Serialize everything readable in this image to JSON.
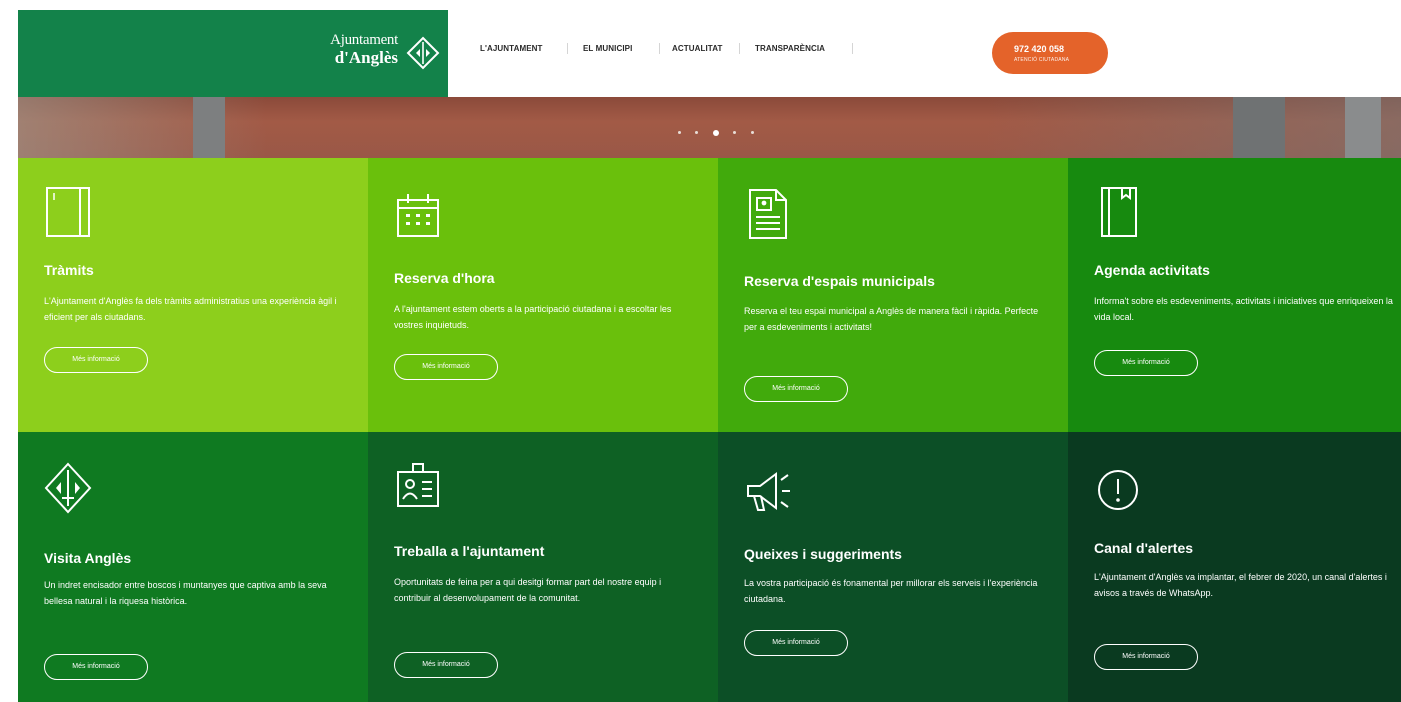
{
  "header": {
    "logo_line1": "Ajuntament",
    "logo_line2": "d'Anglès",
    "nav": [
      "L'AJUNTAMENT",
      "EL MUNICIPI",
      "ACTUALITAT",
      "TRANSPARÈNCIA"
    ],
    "phone": "972 420 058",
    "phone_sub": "ATENCIÓ CIUTADANA"
  },
  "hero": {
    "slides": 5,
    "active_slide": 3
  },
  "tiles": [
    {
      "title": "Tràmits",
      "text": "L'Ajuntament d'Anglès fa dels tràmits administratius una experiència àgil i eficient per als ciutadans.",
      "button": "Més informació",
      "icon": "notebook-icon",
      "bg": "#8dcf1c"
    },
    {
      "title": "Reserva d'hora",
      "text": "A l'ajuntament estem oberts a la participació ciutadana i a escoltar les vostres inquietuds.",
      "button": "Més informació",
      "icon": "calendar-icon",
      "bg": "#6ac00c"
    },
    {
      "title": "Reserva d'espais municipals",
      "text": "Reserva el teu espai municipal a Anglès de manera fàcil i ràpida. Perfecte per a esdeveniments i activitats!",
      "button": "Més informació",
      "icon": "document-icon",
      "bg": "#41aa0c"
    },
    {
      "title": "Agenda activitats",
      "text": "Informa't sobre els esdeveniments, activitats i iniciatives que enriqueixen la vida local.",
      "button": "Més informació",
      "icon": "agenda-book-icon",
      "bg": "#178a0f"
    },
    {
      "title": "Visita Anglès",
      "text": "Un indret encisador entre boscos i muntanyes que captiva amb la seva bellesa natural i la riquesa històrica.",
      "button": "Més informació",
      "icon": "angles-shield-icon",
      "bg": "#0f7a21"
    },
    {
      "title": "Treballa a l'ajuntament",
      "text": "Oportunitats de feina per a qui desitgi formar part del nostre equip i contribuir al desenvolupament de la comunitat.",
      "button": "Més informació",
      "icon": "id-card-icon",
      "bg": "#0e6124"
    },
    {
      "title": "Queixes i suggeriments",
      "text": "La vostra participació és fonamental per millorar els serveis i l'experiència ciutadana.",
      "button": "Més informació",
      "icon": "megaphone-icon",
      "bg": "#0c4f26"
    },
    {
      "title": "Canal d'alertes",
      "text": "L'Ajuntament d'Anglès va implantar, el febrer de 2020, un canal d'alertes i avisos a través de WhatsApp.",
      "button": "Més informació",
      "icon": "alert-circle-icon",
      "bg": "#0a3a20"
    }
  ]
}
